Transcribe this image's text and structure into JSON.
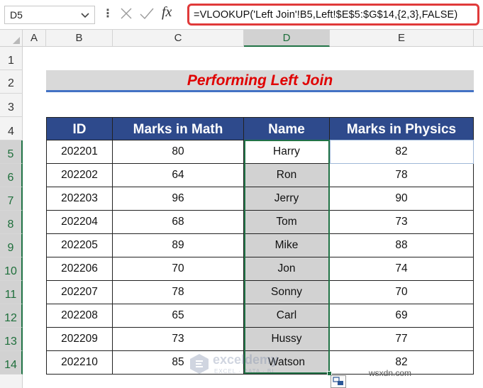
{
  "formula_bar": {
    "name_box": "D5",
    "formula": "=VLOOKUP('Left Join'!B5,Left!$E$5:$G$14,{2,3},FALSE)",
    "fx_label": "fx"
  },
  "columns": [
    "A",
    "B",
    "C",
    "D",
    "E"
  ],
  "selected_column": "D",
  "rows": [
    "1",
    "2",
    "3",
    "4",
    "5",
    "6",
    "7",
    "8",
    "9",
    "10",
    "11",
    "12",
    "13",
    "14"
  ],
  "title": "Performing Left Join",
  "table": {
    "headers": [
      "ID",
      "Marks in Math",
      "Name",
      "Marks in Physics"
    ],
    "rows": [
      [
        "202201",
        "80",
        "Harry",
        "82"
      ],
      [
        "202202",
        "64",
        "Ron",
        "78"
      ],
      [
        "202203",
        "96",
        "Jerry",
        "90"
      ],
      [
        "202204",
        "68",
        "Tom",
        "73"
      ],
      [
        "202205",
        "89",
        "Mike",
        "88"
      ],
      [
        "202206",
        "70",
        "Jon",
        "74"
      ],
      [
        "202207",
        "78",
        "Sonny",
        "70"
      ],
      [
        "202208",
        "65",
        "Carl",
        "69"
      ],
      [
        "202209",
        "73",
        "Hussy",
        "77"
      ],
      [
        "202210",
        "85",
        "Watson",
        "82"
      ]
    ]
  },
  "watermark": "wsxdn.com",
  "logo_watermark": {
    "title": "exceldemy",
    "subtitle": "EXCEL · DATA · BI"
  },
  "colors": {
    "accent": "#217346",
    "header_fill": "#2e4a8c",
    "title_color": "#e00000",
    "formula_highlight": "#e03a3a"
  }
}
